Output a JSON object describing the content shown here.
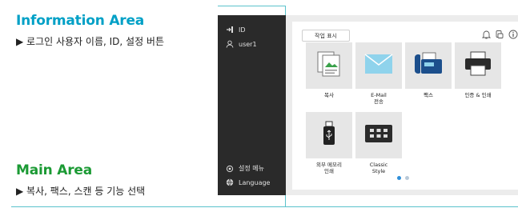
{
  "annotations": {
    "info_title": "Information Area",
    "info_desc": "▶ 로그인 사용자 이름, ID, 설정 버튼",
    "main_title": "Main Area",
    "main_desc": "▶ 복사, 팩스, 스캔 등 기능 선택"
  },
  "sidebar": {
    "id_label": "ID",
    "user_label": "user1",
    "settings_label": "설정 메뉴",
    "language_label": "Language"
  },
  "main": {
    "task_button_label": "작업 표시",
    "tiles": [
      {
        "name": "copy",
        "label": "복사",
        "label2": ""
      },
      {
        "name": "email",
        "label": "E-Mail",
        "label2": "전송"
      },
      {
        "name": "fax",
        "label": "팩스",
        "label2": ""
      },
      {
        "name": "auth-print",
        "label": "인증 & 인쇄",
        "label2": ""
      },
      {
        "name": "usb-print",
        "label": "외부 메모리",
        "label2": "인쇄"
      },
      {
        "name": "classic-style",
        "label": "Classic",
        "label2": "Style"
      }
    ],
    "page_indicator": {
      "current": 1,
      "total": 2
    }
  },
  "colors": {
    "accent_blue": "#00a0c6",
    "accent_green": "#1b9a34",
    "guide_line": "#5bc2cc",
    "sidebar_bg": "#2a2a2a",
    "dot_active": "#2f8ed8",
    "dot_inactive": "#b8c9d8"
  }
}
